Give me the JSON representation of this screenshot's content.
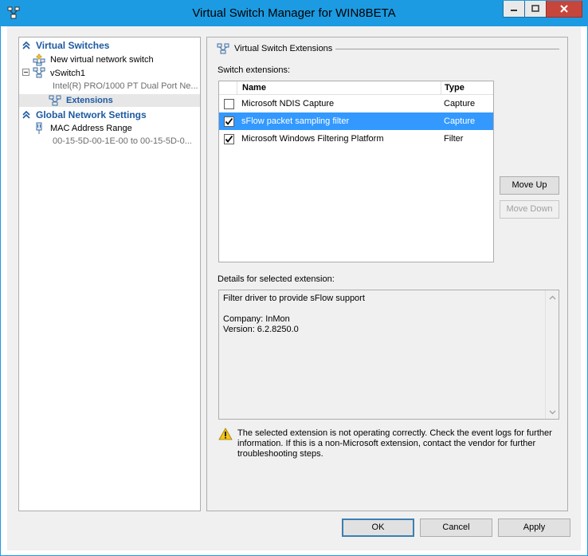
{
  "window": {
    "title": "Virtual Switch Manager for WIN8BETA"
  },
  "left": {
    "virtual_switches_header": "Virtual Switches",
    "new_switch_label": "New virtual network switch",
    "vswitch_label": "vSwitch1",
    "vswitch_adapter": "Intel(R) PRO/1000 PT Dual Port Ne...",
    "extensions_label": "Extensions",
    "global_header": "Global Network Settings",
    "mac_label": "MAC Address Range",
    "mac_range": "00-15-5D-00-1E-00 to 00-15-5D-0..."
  },
  "right": {
    "group_title": "Virtual Switch Extensions",
    "switch_extensions_label": "Switch extensions:",
    "columns": {
      "name": "Name",
      "type": "Type"
    },
    "extensions": [
      {
        "name": "Microsoft NDIS Capture",
        "type": "Capture",
        "checked": false,
        "selected": false
      },
      {
        "name": "sFlow packet sampling filter",
        "type": "Capture",
        "checked": true,
        "selected": true
      },
      {
        "name": "Microsoft Windows Filtering Platform",
        "type": "Filter",
        "checked": true,
        "selected": false
      }
    ],
    "move_up": "Move Up",
    "move_down": "Move Down",
    "details_label": "Details for selected extension:",
    "details_text": "Filter driver to provide sFlow support\n\nCompany: InMon\nVersion: 6.2.8250.0",
    "warning_text": "The selected extension is not operating correctly. Check the event logs for further information. If this is a non-Microsoft extension, contact the vendor for further troubleshooting steps."
  },
  "buttons": {
    "ok": "OK",
    "cancel": "Cancel",
    "apply": "Apply"
  },
  "colors": {
    "title_bar": "#1c9be2",
    "section_header": "#1d5aa0",
    "selection": "#3399ff",
    "close_button": "#c7463c"
  }
}
